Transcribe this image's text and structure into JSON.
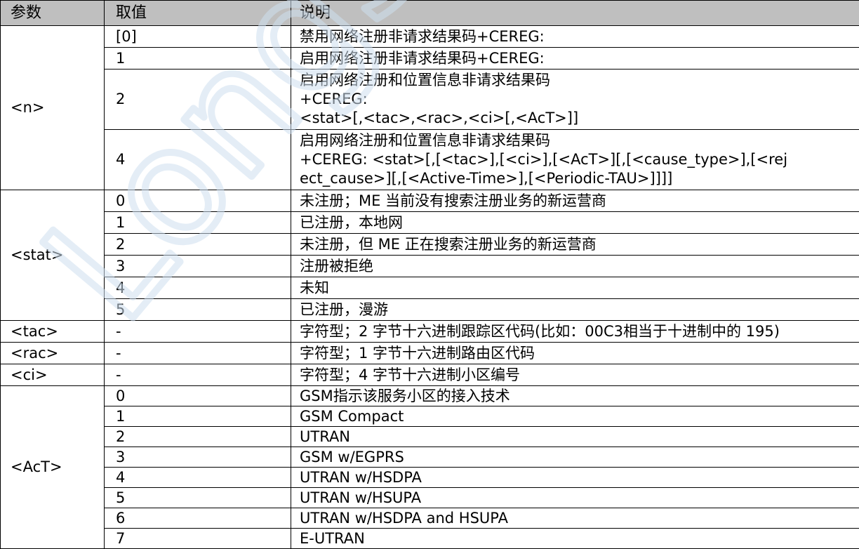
{
  "headers": {
    "param": "参数",
    "value": "取值",
    "desc": "说明"
  },
  "params": {
    "n": "<n>",
    "stat": "<stat>",
    "tac": "<tac>",
    "rac": "<rac>",
    "ci": "<ci>",
    "act": "<AcT>"
  },
  "rows": {
    "n": [
      {
        "value": "[0]",
        "desc": [
          "禁用网络注册非请求结果码+CEREG:"
        ]
      },
      {
        "value": "1",
        "desc": [
          "启用网络注册非请求结果码+CEREG:"
        ]
      },
      {
        "value": "2",
        "desc": [
          "启用网络注册和位置信息非请求结果码",
          "+CEREG:",
          "<stat>[,<tac>,<rac>,<ci>[,<AcT>]]"
        ]
      },
      {
        "value": "4",
        "desc": [
          "启用网络注册和位置信息非请求结果码",
          "+CEREG:  <stat>[,[<tac>],[<ci>],[<AcT>][,[<cause_type>],[<rej",
          "ect_cause>][,[<Active-Time>],[<Periodic-TAU>]]]]"
        ]
      }
    ],
    "stat": [
      {
        "value": "0",
        "desc": "未注册；ME 当前没有搜索注册业务的新运营商"
      },
      {
        "value": "1",
        "desc": "已注册，本地网"
      },
      {
        "value": "2",
        "desc": "未注册，但 ME 正在搜索注册业务的新运营商"
      },
      {
        "value": "3",
        "desc": "注册被拒绝"
      },
      {
        "value": "4",
        "desc": "未知"
      },
      {
        "value": "5",
        "desc": "已注册，漫游"
      }
    ],
    "tac": {
      "value": "-",
      "desc": "字符型；2 字节十六进制跟踪区代码(比如：00C3相当于十进制中的 195)"
    },
    "rac": {
      "value": "-",
      "desc": "字符型；1 字节十六进制路由区代码"
    },
    "ci": {
      "value": "-",
      "desc": "字符型；4 字节十六进制小区编号"
    },
    "act": [
      {
        "value": "0",
        "desc": "GSM指示该服务小区的接入技术"
      },
      {
        "value": "1",
        "desc": "GSM Compact"
      },
      {
        "value": "2",
        "desc": "UTRAN"
      },
      {
        "value": "3",
        "desc": "GSM w/EGPRS"
      },
      {
        "value": "4",
        "desc": "UTRAN w/HSDPA"
      },
      {
        "value": "5",
        "desc": "UTRAN w/HSUPA"
      },
      {
        "value": "6",
        "desc": "UTRAN w/HSDPA and HSUPA"
      },
      {
        "value": "7",
        "desc": "E-UTRAN"
      }
    ]
  },
  "watermark": {
    "text": "LongSung",
    "color": "#cfe0f0"
  },
  "colors": {
    "header_bg": "#bfbfbf",
    "border": "#000000"
  }
}
